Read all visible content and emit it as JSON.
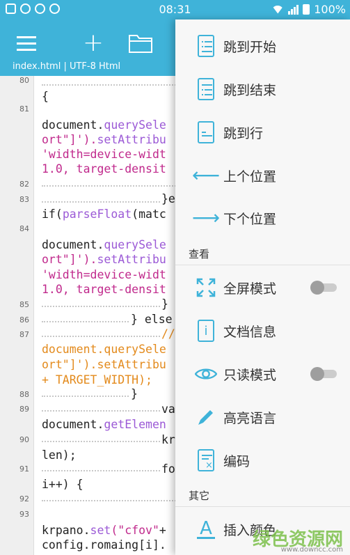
{
  "status_bar": {
    "time": "08:31",
    "battery": "100%"
  },
  "app_bar": {
    "file_info": "index.html  |  UTF-8  Html"
  },
  "editor": {
    "line_numbers": [
      "80",
      "81",
      "82",
      "83",
      "84",
      "85",
      "86",
      "87",
      "88",
      "89",
      "90",
      "91",
      "92",
      "93"
    ],
    "lines": {
      "l80": "{",
      "l81a": "document.",
      "l81a_fn": "querySele",
      "l81b_pre": "ort\"]').",
      "l81b_fn": "setAttribu",
      "l81c": "'width=device-widt",
      "l81d": "1.0, target-densit",
      "l83a": "}e",
      "l83b_pre": "if(",
      "l83b_fn": "parseFloat",
      "l83b_post": "(matc",
      "l84a": "document.",
      "l84a_fn": "querySele",
      "l84b_pre": "ort\"]').",
      "l84b_fn": "setAttribu",
      "l84c": "'width=device-widt",
      "l84d": "1.0, target-densit",
      "l85": "}",
      "l86": "} else",
      "l87a": "//",
      "l87b": "document.querySele",
      "l87c": "ort\"]').setAttribu",
      "l87d": "+ TARGET_WIDTH);",
      "l88": "}",
      "l89a": "va",
      "l89b_pre": "document.",
      "l89b_fn": "getElemen",
      "l90a": "kr",
      "l90b": "len);",
      "l91a": "fo",
      "l91b": "i++) {",
      "l93a_pre": "krpano.",
      "l93a_fn": "set",
      "l93a_str": "(\"cfov\"",
      "l93a_post": "+",
      "l93b": "config.romaing[i]."
    }
  },
  "drawer": {
    "items": [
      {
        "label": "跳到开始"
      },
      {
        "label": "跳到结束"
      },
      {
        "label": "跳到行"
      },
      {
        "label": "上个位置"
      },
      {
        "label": "下个位置"
      }
    ],
    "section_view": "查看",
    "view_items": [
      {
        "label": "全屏模式"
      },
      {
        "label": "文档信息"
      },
      {
        "label": "只读模式"
      },
      {
        "label": "高亮语言"
      },
      {
        "label": "编码"
      }
    ],
    "section_other": "其它",
    "other_items": [
      {
        "label": "插入颜色"
      }
    ]
  },
  "watermark": {
    "text": "绿色资源网",
    "url": "www.downcc.com"
  },
  "colors": {
    "accent": "#3fb3d9",
    "function": "#9b59d6",
    "string": "#c0298c",
    "comment": "#e38a1c"
  }
}
